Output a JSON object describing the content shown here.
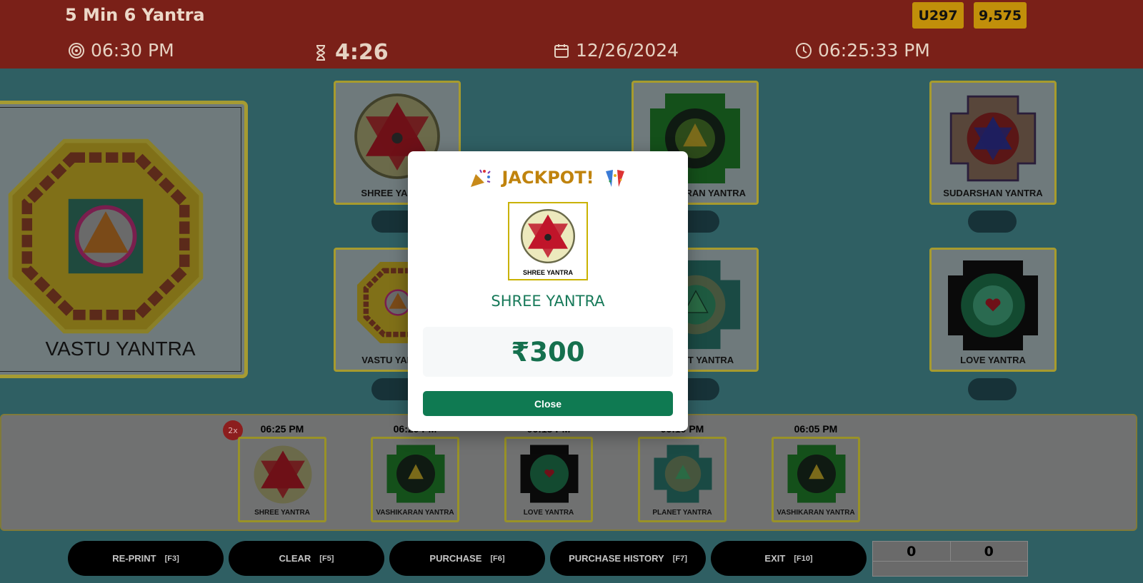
{
  "header": {
    "title": "5 Min 6 Yantra",
    "user_id": "U297",
    "balance": "9,575",
    "draw_time": "06:30 PM",
    "countdown": "4:26",
    "date": "12/26/2024",
    "clock": "06:25:33 PM"
  },
  "board": {
    "featured": {
      "label": "VASTU YANTRA"
    },
    "cards": [
      {
        "label": "SHREE YANTRA",
        "icon": "shree-yantra"
      },
      {
        "label": "VASHIKARAN YANTRA",
        "icon": "vashikaran-yantra"
      },
      {
        "label": "SUDARSHAN YANTRA",
        "icon": "sudarshan-yantra"
      },
      {
        "label": "VASTU YANTRA",
        "icon": "vastu-yantra"
      },
      {
        "label": "PLANET YANTRA",
        "icon": "planet-yantra"
      },
      {
        "label": "LOVE YANTRA",
        "icon": "love-yantra"
      }
    ]
  },
  "history": {
    "multiplier": "2x",
    "items": [
      {
        "time": "06:25 PM",
        "label": "SHREE YANTRA"
      },
      {
        "time": "06:20 PM",
        "label": "VASHIKARAN YANTRA"
      },
      {
        "time": "06:15 PM",
        "label": "LOVE YANTRA"
      },
      {
        "time": "06:10 PM",
        "label": "PLANET YANTRA"
      },
      {
        "time": "06:05 PM",
        "label": "VASHIKARAN YANTRA"
      }
    ]
  },
  "footer": {
    "buttons": [
      {
        "label": "RE-PRINT",
        "key": "[F3]"
      },
      {
        "label": "CLEAR",
        "key": "[F5]"
      },
      {
        "label": "PURCHASE",
        "key": "[F6]"
      },
      {
        "label": "PURCHASE HISTORY",
        "key": "[F7]"
      },
      {
        "label": "EXIT",
        "key": "[F10]"
      }
    ],
    "totals": {
      "qty": "0",
      "amount": "0"
    }
  },
  "modal": {
    "title": "JACKPOT!",
    "image_label": "SHREE YANTRA",
    "yantra_name": "SHREE YANTRA",
    "amount": "₹300",
    "close_label": "Close"
  },
  "colors": {
    "header_bg": "#7a2018",
    "board_bg": "#2f5f63",
    "badge": "#c18f0a",
    "accent_green": "#0f7a52",
    "jackpot_gold": "#c0830d"
  }
}
